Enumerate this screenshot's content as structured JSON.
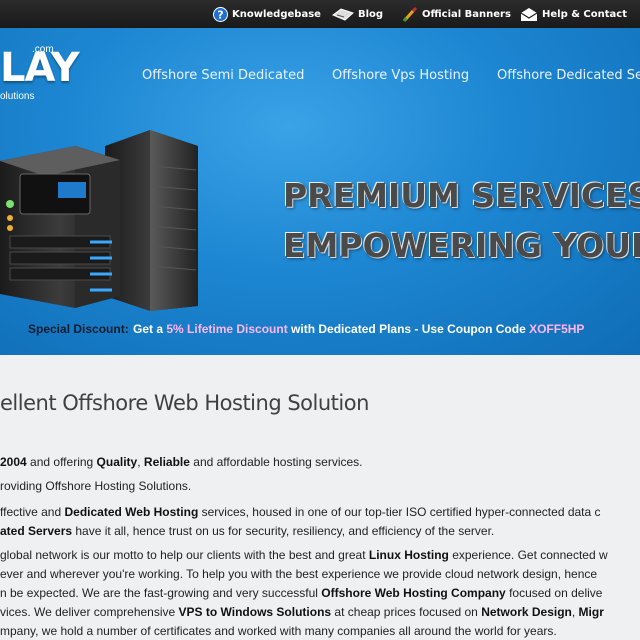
{
  "topbar": {
    "links": [
      {
        "label": "Knowledgebase",
        "icon": "question-icon"
      },
      {
        "label": "Blog",
        "icon": "blog-icon"
      },
      {
        "label": "Official Banners",
        "icon": "brush-icon"
      },
      {
        "label": "Help & Contact",
        "icon": "help-envelope-icon"
      }
    ]
  },
  "logo": {
    "text": "LAY",
    "com": ".com",
    "sub": "olutions"
  },
  "nav": [
    "Offshore Semi Dedicated",
    "Offshore Vps Hosting",
    "Offshore Dedicated Se"
  ],
  "hero": {
    "line1": "PREMIUM SERVICES",
    "line2": "EMPOWERING YOUR BUSIN",
    "discount_label": "Special Discount:",
    "discount_a": "Get a ",
    "discount_b": "5% Lifetime Discount",
    "discount_c": " with Dedicated Plans - Use Coupon Code ",
    "discount_code": "XOFF5HP"
  },
  "content": {
    "heading": "ellent Offshore Web Hosting Solution",
    "l1": [
      " 2004",
      " and offering ",
      "Quality",
      ", ",
      "Reliable",
      " and affordable hosting services."
    ],
    "l2": "roviding Offshore Hosting Solutions.",
    "l3": [
      "ffective and ",
      "Dedicated Web Hosting",
      " services, housed in one of our top-tier ISO certified hyper-connected data c"
    ],
    "l4": [
      "ated Servers",
      " have it all, hence trust on us for security, resiliency, and efficiency of the server."
    ],
    "l5": [
      "global network is our motto to help our clients with the best and great ",
      "Linux Hosting",
      " experience. Get connected w"
    ],
    "l6": "ever and wherever you're working. To help you with the best experience we provide cloud network design, hence",
    "l7": [
      "n be expected. We are the fast-growing and very successful ",
      "Offshore Web Hosting Company",
      " focused on delive"
    ],
    "l8": [
      "vices. We deliver comprehensive ",
      "VPS to Windows Solutions",
      " at cheap prices focused on ",
      "Network Design",
      ", ",
      "Migr"
    ],
    "l9": "mpany, we hold a number of certificates and worked with many companies all around the world for years."
  }
}
